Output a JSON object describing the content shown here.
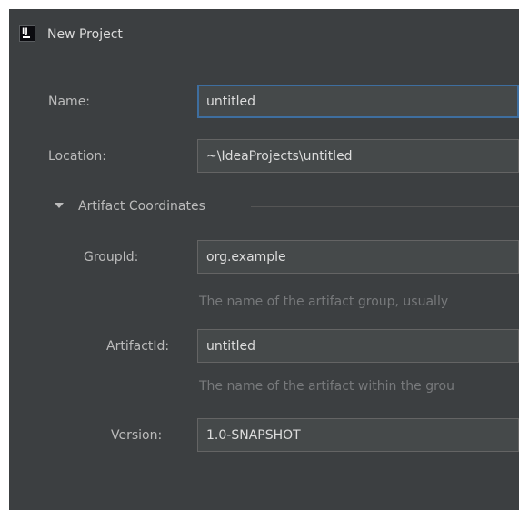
{
  "window": {
    "title": "New Project",
    "icon_text": "IJ"
  },
  "form": {
    "name": {
      "label": "Name:",
      "value": "untitled"
    },
    "location": {
      "label": "Location:",
      "value": "~\\IdeaProjects\\untitled"
    },
    "artifact_section": {
      "title": "Artifact Coordinates",
      "expanded": true,
      "group_id": {
        "label": "GroupId:",
        "value": "org.example",
        "hint": "The name of the artifact group, usually"
      },
      "artifact_id": {
        "label": "ArtifactId:",
        "value": "untitled",
        "hint": "The name of the artifact within the grou"
      },
      "version": {
        "label": "Version:",
        "value": "1.0-SNAPSHOT"
      }
    }
  },
  "colors": {
    "background": "#3c3f41",
    "field_background": "#45494a",
    "field_border": "#646464",
    "focus_border": "#3e6e9f",
    "text": "#bbbbbb",
    "hint_text": "#77797b"
  }
}
